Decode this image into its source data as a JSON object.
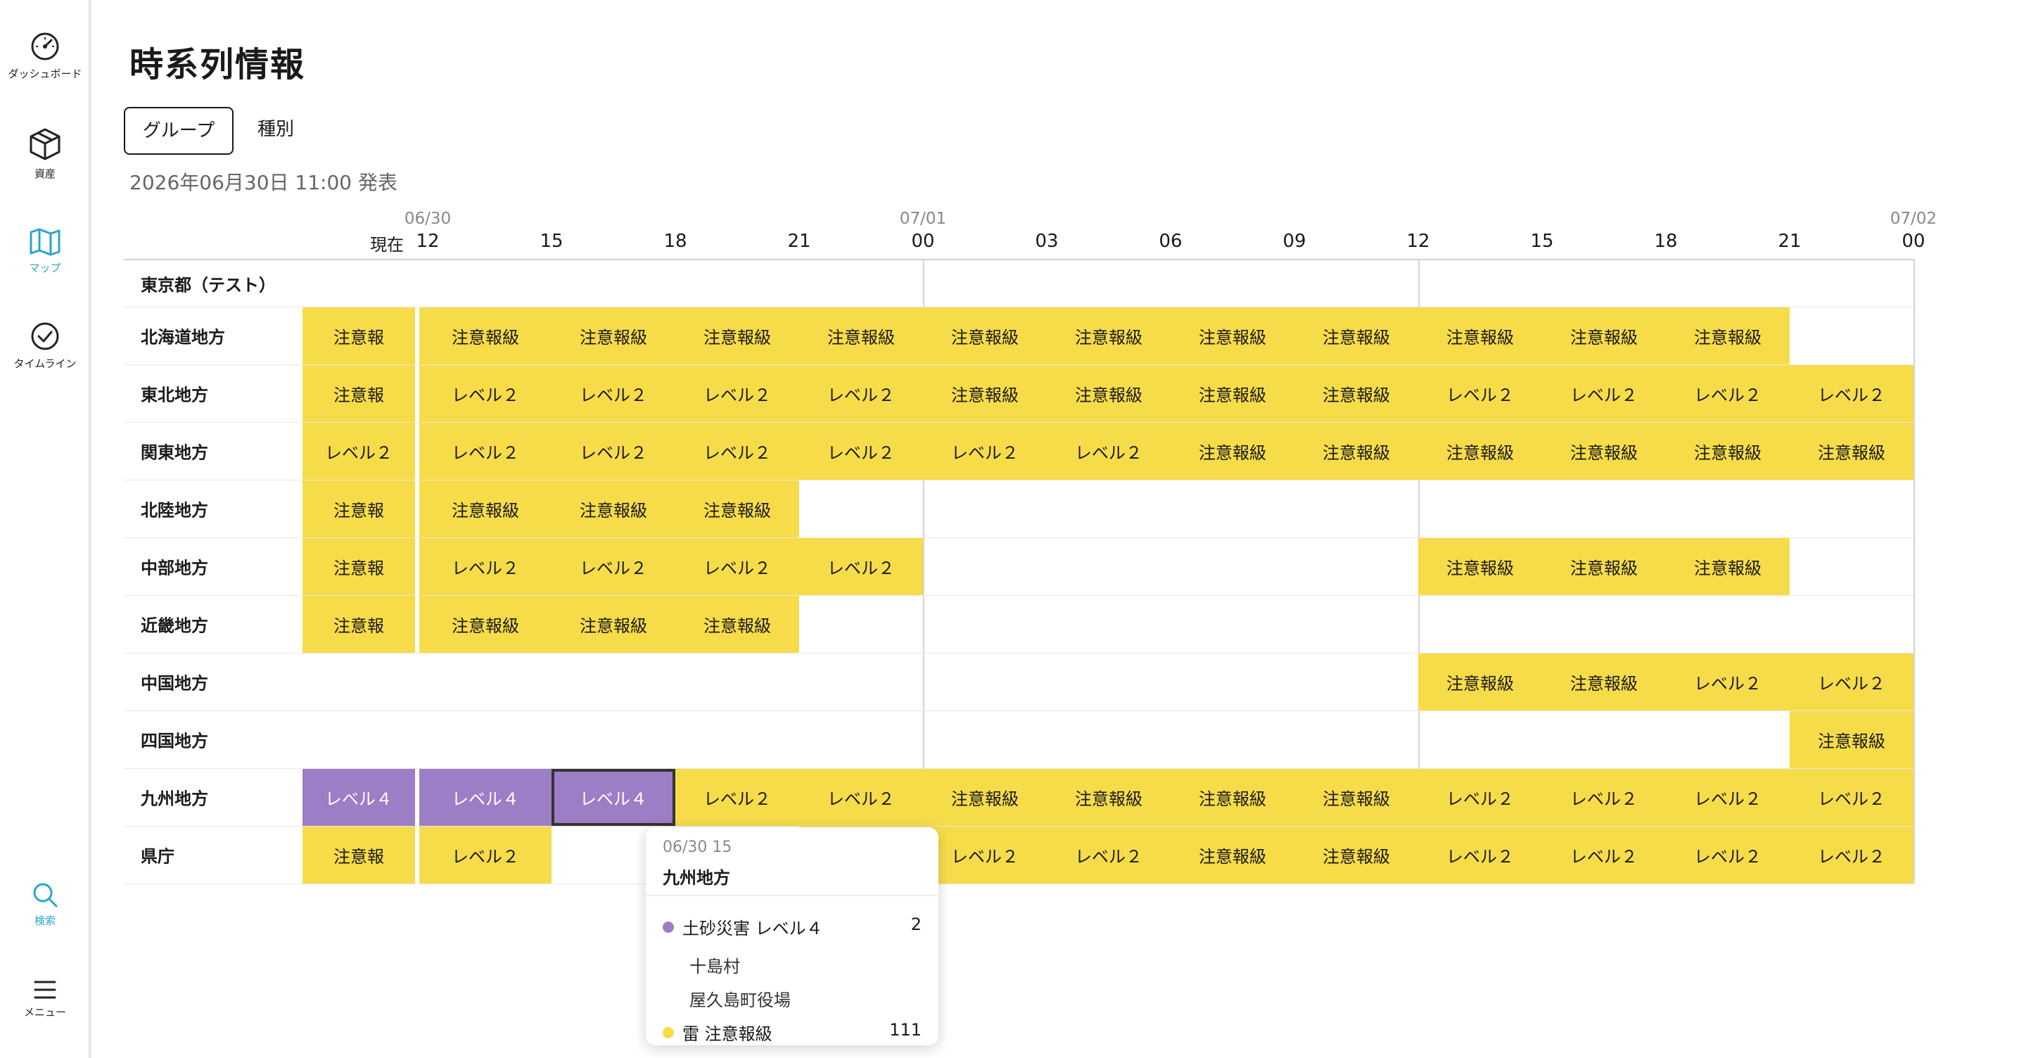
{
  "nav": [
    {
      "label": "ダッシュボード",
      "icon": "gauge-icon"
    },
    {
      "label": "資産",
      "icon": "box-icon"
    },
    {
      "label": "マップ",
      "icon": "map-icon"
    },
    {
      "label": "タイムライン",
      "icon": "check-circle-icon"
    },
    {
      "label": "検索",
      "icon": "search-icon"
    },
    {
      "label": "メニュー",
      "icon": "menu-icon"
    }
  ],
  "active_nav": "マップ",
  "colors": {
    "accent": "#2aa6c7",
    "warning_yellow": "#f7dc4a",
    "level4_purple": "#9b7ec6"
  },
  "page": {
    "title": "時系列情報"
  },
  "tabs": [
    {
      "label": "グループ",
      "selected": true
    },
    {
      "label": "種別",
      "selected": false
    }
  ],
  "issued": "2026年06月30日 11:00 発表",
  "timeline": {
    "now_label": "現在",
    "dates": [
      {
        "label": "06/30",
        "at": 0
      },
      {
        "label": "07/01",
        "at": 4
      },
      {
        "label": "07/02",
        "at": 12
      }
    ],
    "hours": [
      "12",
      "15",
      "18",
      "21",
      "00",
      "03",
      "06",
      "09",
      "12",
      "15",
      "18",
      "21",
      "00"
    ],
    "rows": [
      {
        "name": "東京都（テスト）",
        "now": null,
        "cells": [
          null,
          null,
          null,
          null,
          null,
          null,
          null,
          null,
          null,
          null,
          null,
          null
        ]
      },
      {
        "name": "北海道地方",
        "now": "注意報",
        "cells": [
          "注意報級",
          "注意報級",
          "注意報級",
          "注意報級",
          "注意報級",
          "注意報級",
          "注意報級",
          "注意報級",
          "注意報級",
          "注意報級",
          "注意報級",
          null
        ]
      },
      {
        "name": "東北地方",
        "now": "注意報",
        "cells": [
          "レベル２",
          "レベル２",
          "レベル２",
          "レベル２",
          "注意報級",
          "注意報級",
          "注意報級",
          "注意報級",
          "レベル２",
          "レベル２",
          "レベル２",
          "レベル２"
        ]
      },
      {
        "name": "関東地方",
        "now": "レベル２",
        "cells": [
          "レベル２",
          "レベル２",
          "レベル２",
          "レベル２",
          "レベル２",
          "レベル２",
          "注意報級",
          "注意報級",
          "注意報級",
          "注意報級",
          "注意報級",
          "注意報級"
        ]
      },
      {
        "name": "北陸地方",
        "now": "注意報",
        "cells": [
          "注意報級",
          "注意報級",
          "注意報級",
          null,
          null,
          null,
          null,
          null,
          null,
          null,
          null,
          null
        ]
      },
      {
        "name": "中部地方",
        "now": "注意報",
        "cells": [
          "レベル２",
          "レベル２",
          "レベル２",
          "レベル２",
          null,
          null,
          null,
          null,
          "注意報級",
          "注意報級",
          "注意報級",
          null
        ]
      },
      {
        "name": "近畿地方",
        "now": "注意報",
        "cells": [
          "注意報級",
          "注意報級",
          "注意報級",
          null,
          null,
          null,
          null,
          null,
          null,
          null,
          null,
          null
        ]
      },
      {
        "name": "中国地方",
        "now": null,
        "cells": [
          null,
          null,
          null,
          null,
          null,
          null,
          null,
          null,
          "注意報級",
          "注意報級",
          "レベル２",
          "レベル２"
        ]
      },
      {
        "name": "四国地方",
        "now": null,
        "cells": [
          null,
          null,
          null,
          null,
          null,
          null,
          null,
          null,
          null,
          null,
          null,
          "注意報級"
        ]
      },
      {
        "name": "九州地方",
        "now": "レベル４",
        "cells": [
          "レベル４",
          "レベル４",
          "レベル２",
          "レベル２",
          "注意報級",
          "注意報級",
          "注意報級",
          "注意報級",
          "レベル２",
          "レベル２",
          "レベル２",
          "レベル２"
        ]
      },
      {
        "name": "県庁",
        "now": "注意報",
        "cells": [
          "レベル２",
          null,
          null,
          "レベル２",
          "レベル２",
          "レベル２",
          "注意報級",
          "注意報級",
          "レベル２",
          "レベル２",
          "レベル２",
          "レベル２"
        ]
      }
    ],
    "selected_cell": {
      "row": 9,
      "col": 1
    }
  },
  "tooltip": {
    "time": "06/30 15",
    "region": "九州地方",
    "items": [
      {
        "label": "土砂災害 レベル４",
        "count": "2",
        "color": "#9b7ec6",
        "places": [
          "十島村",
          "屋久島町役場"
        ]
      },
      {
        "label": "雷 注意報級",
        "count": "111",
        "color": "#f7dc4a",
        "places": []
      }
    ]
  }
}
